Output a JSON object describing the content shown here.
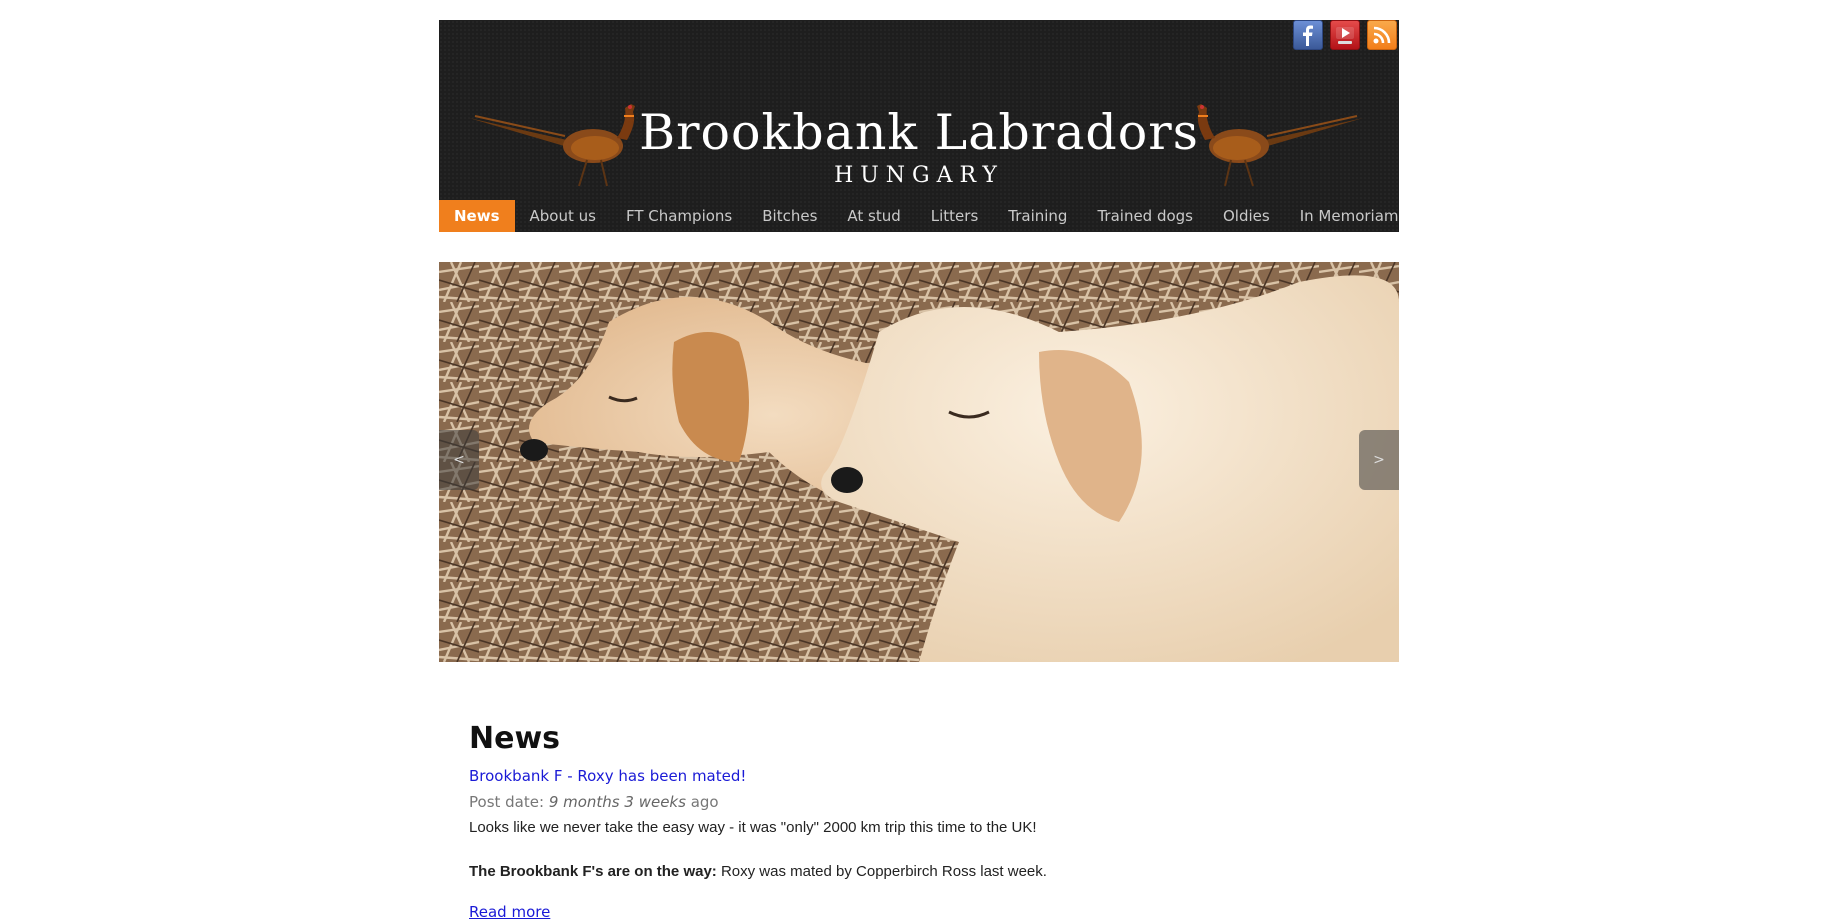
{
  "header": {
    "title": "Brookbank Labradors",
    "subtitle": "HUNGARY",
    "social_icons": [
      "facebook-icon",
      "youtube-icon",
      "rss-icon"
    ]
  },
  "nav": {
    "items": [
      "News",
      "About us",
      "FT Champions",
      "Bitches",
      "At stud",
      "Litters",
      "Training",
      "Trained dogs",
      "Oldies",
      "In Memoriam"
    ],
    "active": "News"
  },
  "slider": {
    "prev_label": "<",
    "next_label": ">"
  },
  "main": {
    "page_title": "News",
    "post": {
      "title": "Brookbank F - Roxy has been mated!",
      "date_label": "Post date:",
      "date_value": "9 months 3 weeks",
      "date_suffix": "ago",
      "body_1": "Looks like we never take the easy way - it was \"only\" 2000 km trip this time to the UK!",
      "body_2_bold": "The Brookbank F's are on the way:",
      "body_2_rest": " Roxy was mated by Copperbirch Ross last week.",
      "read_more": "Read more"
    }
  },
  "colors": {
    "header_bg": "#1e1e1e",
    "nav_active": "#f07f1d",
    "link": "#1a1ad6"
  }
}
